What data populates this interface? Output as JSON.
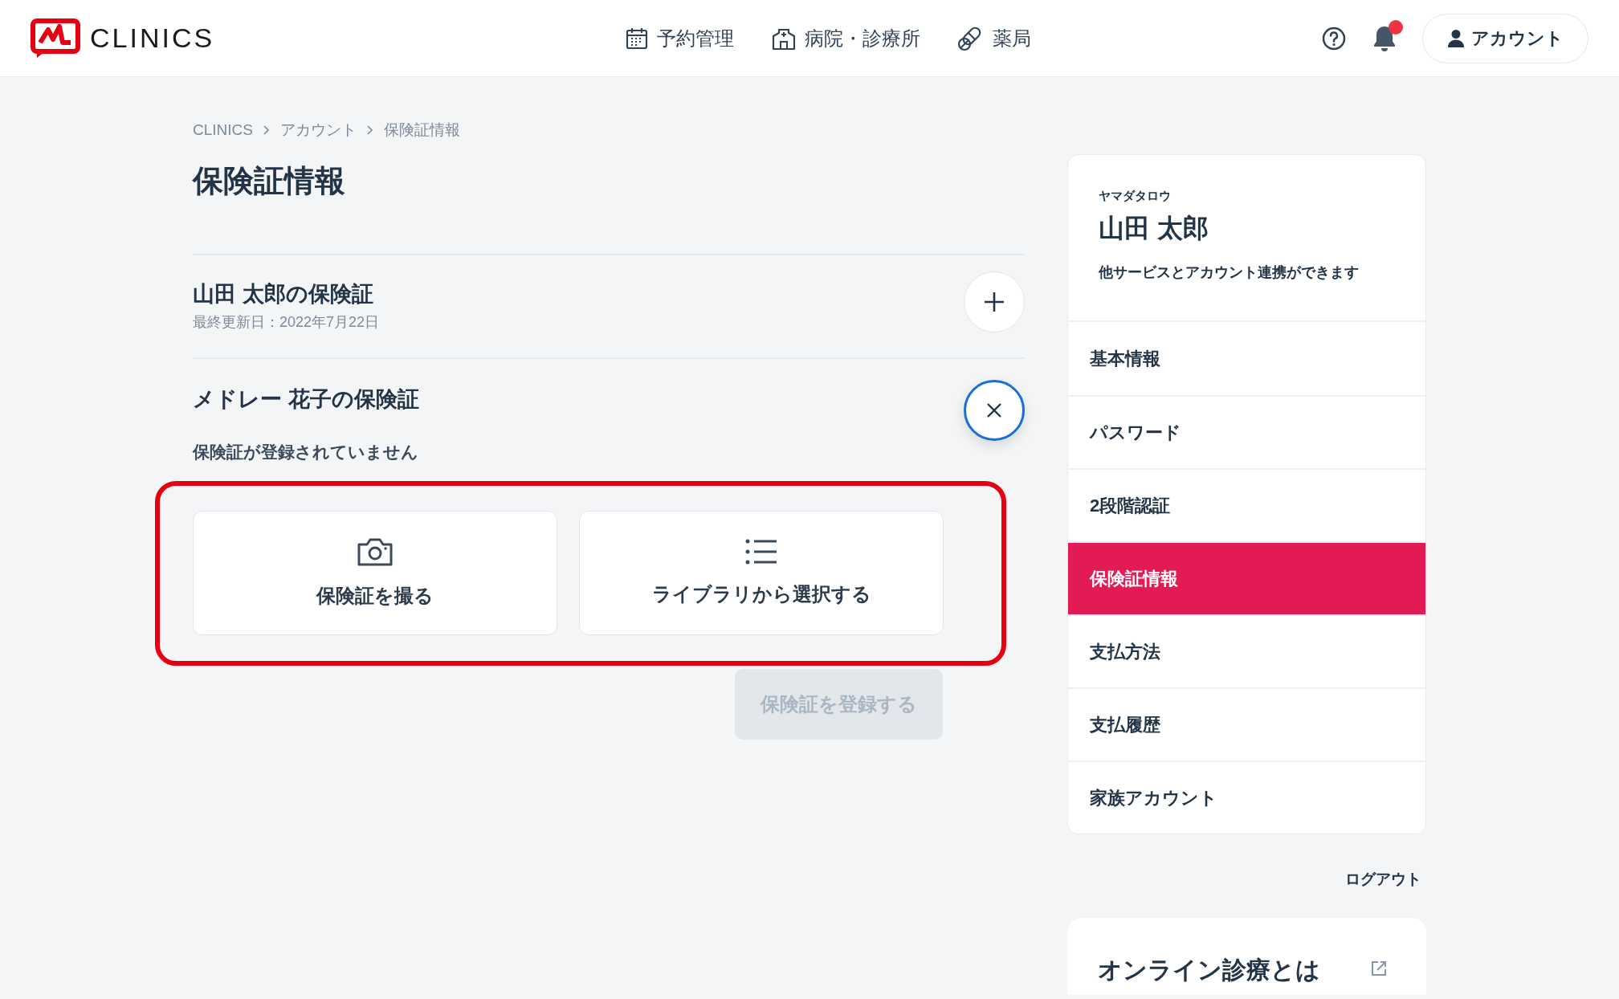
{
  "header": {
    "logo": "CLINICS",
    "nav": [
      {
        "kind": "calendar",
        "label": "予約管理"
      },
      {
        "kind": "hospital",
        "label": "病院・診療所"
      },
      {
        "kind": "pill",
        "label": "薬局"
      }
    ],
    "notification_badge": true,
    "account_button": "アカウント"
  },
  "breadcrumb": [
    "CLINICS",
    "アカウント",
    "保険証情報"
  ],
  "page_title": "保険証情報",
  "insurance_sections": [
    {
      "title": "山田 太郎の保険証",
      "subtitle": "最終更新日：2022年7月22日",
      "expanded": false
    },
    {
      "title": "メドレー 花子の保険証",
      "status": "保険証が登録されていません",
      "expanded": true,
      "options": [
        {
          "kind": "camera",
          "label": "保険証を撮る"
        },
        {
          "kind": "list",
          "label": "ライブラリから選択する"
        }
      ],
      "register_button": {
        "label": "保険証を登録する",
        "disabled": true
      }
    }
  ],
  "profile": {
    "kana": "ヤマダタロウ",
    "name": "山田 太郎",
    "note": "他サービスとアカウント連携ができます"
  },
  "sidebar": {
    "items": [
      {
        "label": "基本情報",
        "selected": false
      },
      {
        "label": "パスワード",
        "selected": false
      },
      {
        "label": "2段階認証",
        "selected": false
      },
      {
        "label": "保険証情報",
        "selected": true
      },
      {
        "label": "支払方法",
        "selected": false
      },
      {
        "label": "支払履歴",
        "selected": false
      },
      {
        "label": "家族アカウント",
        "selected": false
      }
    ]
  },
  "logout": "ログアウト",
  "info_card": {
    "title": "オンライン診療とは"
  }
}
